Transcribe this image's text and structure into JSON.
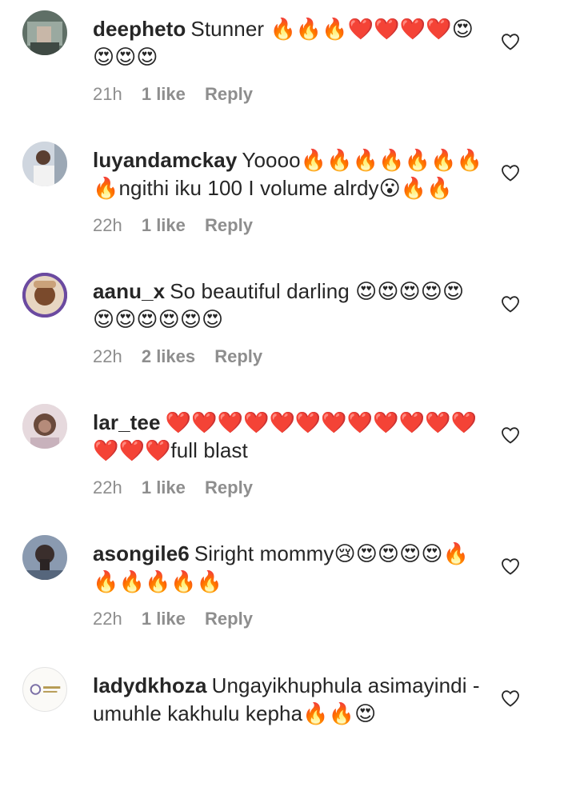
{
  "comments": [
    {
      "username": "deepheto",
      "text": "Stunner 🔥🔥🔥❤️❤️❤️❤️😍😍😍😍",
      "time": "21h",
      "likes": "1 like",
      "reply": "Reply",
      "avatar_color": "#6f7f72"
    },
    {
      "username": "luyandamckay",
      "text": "Yoooo🔥🔥🔥🔥🔥🔥🔥🔥ngithi iku 100 I volume alrdy😮🔥🔥",
      "time": "22h",
      "likes": "1 like",
      "reply": "Reply",
      "avatar_color": "#c9d2dd"
    },
    {
      "username": "aanu_x",
      "text": "So beautiful darling 😍😍😍😍😍😍😍😍😍😍😍",
      "time": "22h",
      "likes": "2 likes",
      "reply": "Reply",
      "avatar_color": "#b67f56"
    },
    {
      "username": "lar_tee",
      "text": "❤️❤️❤️❤️❤️❤️❤️❤️❤️❤️❤️❤️❤️❤️❤️full blast",
      "time": "22h",
      "likes": "1 like",
      "reply": "Reply",
      "avatar_color": "#d8c2c8"
    },
    {
      "username": "asongile6",
      "text": "Siright mommy😢😍😍😍😍🔥🔥🔥🔥🔥🔥",
      "time": "22h",
      "likes": "1 like",
      "reply": "Reply",
      "avatar_color": "#7d8ea5"
    },
    {
      "username": "ladydkhoza",
      "text": "Ungayikhuphula asimayindi -umuhle kakhulu kepha🔥🔥😍",
      "time": "",
      "likes": "",
      "reply": "",
      "avatar_color": "#f3f1ec"
    }
  ],
  "icons": {
    "like": "heart-outline-icon"
  },
  "colors": {
    "meta_text": "#8e8e8e",
    "primary_text": "#262626"
  }
}
